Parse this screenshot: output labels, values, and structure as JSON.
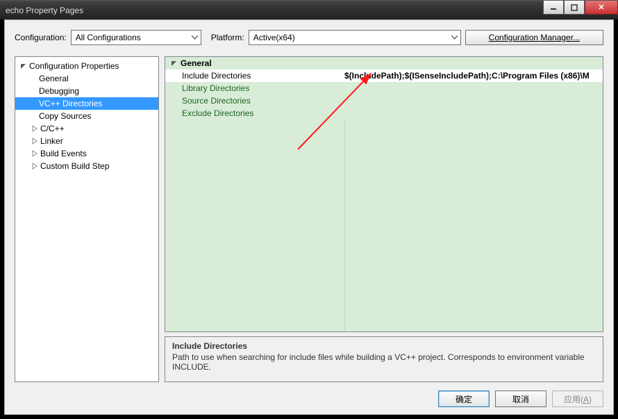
{
  "window": {
    "title": "echo Property Pages"
  },
  "toolbar": {
    "configuration_label": "Configuration:",
    "configuration_value": "All Configurations",
    "platform_label": "Platform:",
    "platform_value": "Active(x64)",
    "config_manager_label": "Configuration Manager..."
  },
  "tree": {
    "root_label": "Configuration Properties",
    "items": [
      {
        "label": "General",
        "expandable": false
      },
      {
        "label": "Debugging",
        "expandable": false
      },
      {
        "label": "VC++ Directories",
        "expandable": false,
        "selected": true
      },
      {
        "label": "Copy Sources",
        "expandable": false
      },
      {
        "label": "C/C++",
        "expandable": true
      },
      {
        "label": "Linker",
        "expandable": true
      },
      {
        "label": "Build Events",
        "expandable": true
      },
      {
        "label": "Custom Build Step",
        "expandable": true
      }
    ]
  },
  "grid": {
    "section": "General",
    "rows": [
      {
        "label": "Include Directories",
        "value": "$(IncludePath);$(ISenseIncludePath);C:\\Program Files (x86)\\M",
        "selected": true
      },
      {
        "label": "Library Directories",
        "value": ""
      },
      {
        "label": "Source Directories",
        "value": ""
      },
      {
        "label": "Exclude Directories",
        "value": ""
      }
    ]
  },
  "description": {
    "title": "Include Directories",
    "body": "Path to use when searching for include files while building a VC++ project.  Corresponds to environment variable INCLUDE."
  },
  "footer": {
    "ok_label": "确定",
    "cancel_label": "取消",
    "apply_label_prefix": "应用(",
    "apply_label_key": "A",
    "apply_label_suffix": ")"
  }
}
